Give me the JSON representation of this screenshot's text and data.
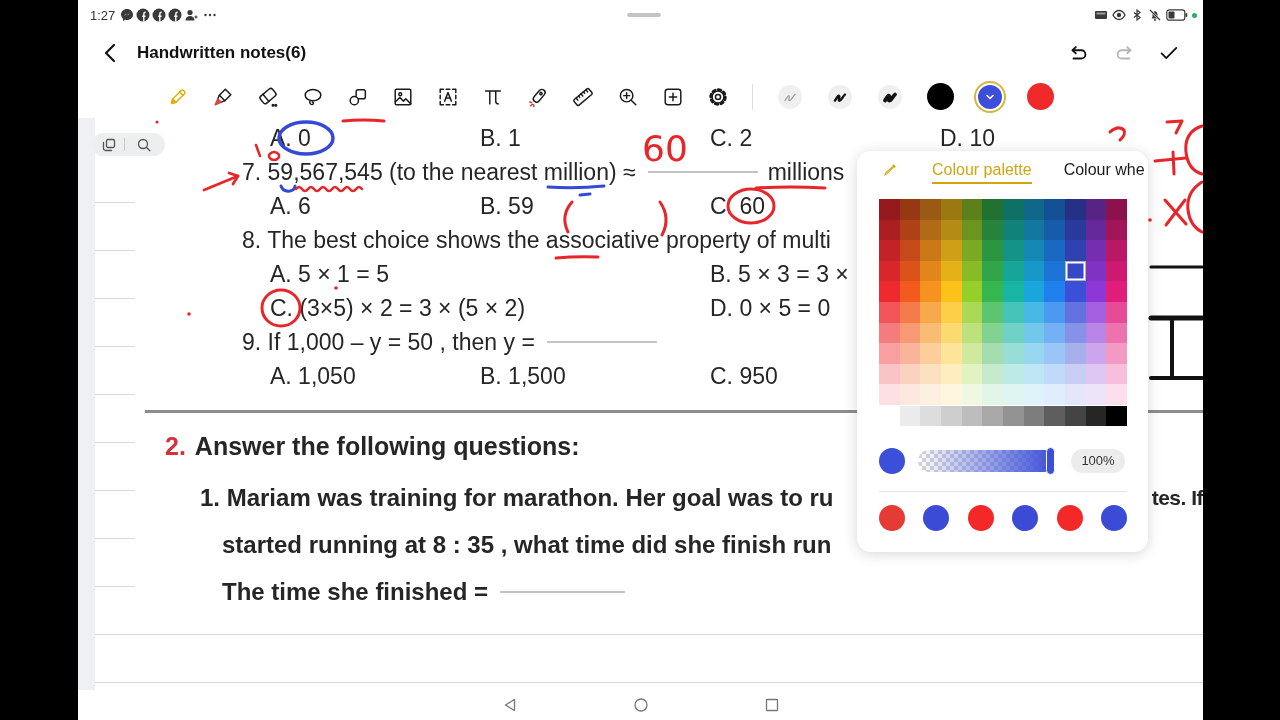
{
  "status_bar": {
    "time": "1:27"
  },
  "header": {
    "title": "Handwritten notes(6)",
    "actions": [
      {
        "kind": "undo",
        "disabled": false
      },
      {
        "kind": "redo",
        "disabled": true
      },
      {
        "kind": "done",
        "disabled": false
      }
    ]
  },
  "toolbar": {
    "tools": [
      {
        "kind": "pencil",
        "selected": true
      },
      {
        "kind": "marker",
        "selected": false
      },
      {
        "kind": "eraser",
        "selected": false
      },
      {
        "kind": "lasso",
        "selected": false
      },
      {
        "kind": "shapes",
        "selected": false
      },
      {
        "kind": "image",
        "selected": false
      },
      {
        "kind": "text",
        "selected": false
      },
      {
        "kind": "formula",
        "selected": false
      },
      {
        "kind": "laser",
        "selected": false
      },
      {
        "kind": "ruler",
        "selected": false
      },
      {
        "kind": "zoom",
        "selected": false
      },
      {
        "kind": "add",
        "selected": false
      },
      {
        "kind": "settings",
        "selected": false
      }
    ],
    "stroke_widths": [
      {
        "kind": "thin",
        "selected": false
      },
      {
        "kind": "medium",
        "selected": false
      },
      {
        "kind": "thick",
        "selected": false
      }
    ],
    "pen_colors": [
      {
        "color": "#000000",
        "selected": false
      },
      {
        "color": "#3b4fd8",
        "selected": true
      },
      {
        "color": "#f02a2a",
        "selected": false
      }
    ]
  },
  "worksheet": {
    "rows": [
      {
        "kind": "choices",
        "options": [
          "A. 0",
          "B. 1",
          "C. 2",
          "D. 10"
        ]
      },
      {
        "kind": "question",
        "text": "7. 59,567,545 (to the nearest million) ≈",
        "blank": true,
        "unit": "millions"
      },
      {
        "kind": "choices",
        "options": [
          "A. 6",
          "B. 59",
          "C. 60"
        ]
      },
      {
        "kind": "question",
        "text": "8. The best choice shows the associative property of multi"
      },
      {
        "kind": "choice_pair",
        "options": [
          "A. 5 × 1 = 5",
          "B. 5 × 3 = 3 ×"
        ]
      },
      {
        "kind": "choice_pair",
        "options": [
          "C. (3×5) × 2 = 3 × (5 × 2)",
          "D. 0 × 5 = 0"
        ]
      },
      {
        "kind": "question",
        "text": "9. If 1,000 – y = 50 , then y =",
        "blank": true
      },
      {
        "kind": "choices",
        "options": [
          "A. 1,050",
          "B. 1,500",
          "C. 950"
        ]
      }
    ],
    "section": {
      "number": "2.",
      "title": "Answer the following questions:",
      "lines": [
        {
          "text": "1. Mariam was training for marathon. Her goal was to ru",
          "tail": "tes. If"
        },
        {
          "text": "started running at 8 : 35 , what time did she finish run"
        },
        {
          "text": "The time she finished =",
          "blank": true
        }
      ]
    }
  },
  "handwriting": [
    {
      "text": "60"
    }
  ],
  "colour_panel": {
    "tabs": [
      {
        "label": "Colour palette",
        "selected": true
      },
      {
        "label": "Colour whe",
        "selected": false
      }
    ],
    "palette": [
      [
        {
          "color": "#941a1d",
          "selected": false
        },
        {
          "color": "#963813",
          "selected": false
        },
        {
          "color": "#995b13",
          "selected": false
        },
        {
          "color": "#9c7810",
          "selected": false
        },
        {
          "color": "#5c801a",
          "selected": false
        },
        {
          "color": "#217131",
          "selected": false
        },
        {
          "color": "#0f7066",
          "selected": false
        },
        {
          "color": "#106789",
          "selected": false
        },
        {
          "color": "#134f94",
          "selected": false
        },
        {
          "color": "#253186",
          "selected": false
        },
        {
          "color": "#572385",
          "selected": false
        },
        {
          "color": "#8c124d",
          "selected": false
        }
      ],
      [
        {
          "color": "#ab1e22",
          "selected": false
        },
        {
          "color": "#ae4116",
          "selected": false
        },
        {
          "color": "#b16a16",
          "selected": false
        },
        {
          "color": "#b58c13",
          "selected": false
        },
        {
          "color": "#6b951e",
          "selected": false
        },
        {
          "color": "#268339",
          "selected": false
        },
        {
          "color": "#118277",
          "selected": false
        },
        {
          "color": "#13789f",
          "selected": false
        },
        {
          "color": "#165cab",
          "selected": false
        },
        {
          "color": "#2a399c",
          "selected": false
        },
        {
          "color": "#66289a",
          "selected": false
        },
        {
          "color": "#a21559",
          "selected": false
        }
      ],
      [
        {
          "color": "#c32227",
          "selected": false
        },
        {
          "color": "#c64a19",
          "selected": false
        },
        {
          "color": "#ca7919",
          "selected": false
        },
        {
          "color": "#cf9f15",
          "selected": false
        },
        {
          "color": "#7aaa22",
          "selected": false
        },
        {
          "color": "#2b9541",
          "selected": false
        },
        {
          "color": "#149487",
          "selected": false
        },
        {
          "color": "#1588b5",
          "selected": false
        },
        {
          "color": "#1969c3",
          "selected": false
        },
        {
          "color": "#3041b1",
          "selected": false
        },
        {
          "color": "#742eaf",
          "selected": false
        },
        {
          "color": "#b91866",
          "selected": false
        }
      ],
      [
        {
          "color": "#d9262b",
          "selected": false
        },
        {
          "color": "#dc521b",
          "selected": false
        },
        {
          "color": "#e0861b",
          "selected": false
        },
        {
          "color": "#e5b118",
          "selected": false
        },
        {
          "color": "#88bc26",
          "selected": false
        },
        {
          "color": "#30a648",
          "selected": false
        },
        {
          "color": "#16a596",
          "selected": false
        },
        {
          "color": "#1897c9",
          "selected": false
        },
        {
          "color": "#1c74d9",
          "selected": false
        },
        {
          "color": "#3648c5",
          "selected": true
        },
        {
          "color": "#8033c3",
          "selected": false
        },
        {
          "color": "#cd1a71",
          "selected": false
        }
      ],
      [
        {
          "color": "#ee2a2f",
          "selected": false
        },
        {
          "color": "#f25a1e",
          "selected": false
        },
        {
          "color": "#f6931e",
          "selected": false
        },
        {
          "color": "#fcc21a",
          "selected": false
        },
        {
          "color": "#95cf2a",
          "selected": false
        },
        {
          "color": "#35b64f",
          "selected": false
        },
        {
          "color": "#18b5a5",
          "selected": false
        },
        {
          "color": "#1aa6dd",
          "selected": false
        },
        {
          "color": "#1f80ee",
          "selected": false
        },
        {
          "color": "#3b4fd8",
          "selected": false
        },
        {
          "color": "#8d38d6",
          "selected": false
        },
        {
          "color": "#e11d7c",
          "selected": false
        }
      ],
      [
        {
          "color": "#f15559",
          "selected": false
        },
        {
          "color": "#f57b4b",
          "selected": false
        },
        {
          "color": "#f8a94b",
          "selected": false
        },
        {
          "color": "#fdce48",
          "selected": false
        },
        {
          "color": "#aad955",
          "selected": false
        },
        {
          "color": "#5dc572",
          "selected": false
        },
        {
          "color": "#46c4b7",
          "selected": false
        },
        {
          "color": "#48b8e4",
          "selected": false
        },
        {
          "color": "#4c99f1",
          "selected": false
        },
        {
          "color": "#6272e0",
          "selected": false
        },
        {
          "color": "#a460de",
          "selected": false
        },
        {
          "color": "#e74a96",
          "selected": false
        }
      ],
      [
        {
          "color": "#f47b7e",
          "selected": false
        },
        {
          "color": "#f79973",
          "selected": false
        },
        {
          "color": "#f9bc73",
          "selected": false
        },
        {
          "color": "#fdd971",
          "selected": false
        },
        {
          "color": "#bde17b",
          "selected": false
        },
        {
          "color": "#82d292",
          "selected": false
        },
        {
          "color": "#70d1c7",
          "selected": false
        },
        {
          "color": "#71c8ea",
          "selected": false
        },
        {
          "color": "#74b0f4",
          "selected": false
        },
        {
          "color": "#8592e7",
          "selected": false
        },
        {
          "color": "#b884e6",
          "selected": false
        },
        {
          "color": "#ec73ae",
          "selected": false
        }
      ],
      [
        {
          "color": "#f79fa1",
          "selected": false
        },
        {
          "color": "#f9b49a",
          "selected": false
        },
        {
          "color": "#fbce9a",
          "selected": false
        },
        {
          "color": "#fee498",
          "selected": false
        },
        {
          "color": "#cfe99f",
          "selected": false
        },
        {
          "color": "#a4deb0",
          "selected": false
        },
        {
          "color": "#97ded7",
          "selected": false
        },
        {
          "color": "#98d7f0",
          "selected": false
        },
        {
          "color": "#9ac6f7",
          "selected": false
        },
        {
          "color": "#a7b0ed",
          "selected": false
        },
        {
          "color": "#cca5ed",
          "selected": false
        },
        {
          "color": "#f299c4",
          "selected": false
        }
      ],
      [
        {
          "color": "#fac3c5",
          "selected": false
        },
        {
          "color": "#fbd1c0",
          "selected": false
        },
        {
          "color": "#fce1c0",
          "selected": false
        },
        {
          "color": "#feeebf",
          "selected": false
        },
        {
          "color": "#e1f2c3",
          "selected": false
        },
        {
          "color": "#c6eace",
          "selected": false
        },
        {
          "color": "#beeae6",
          "selected": false
        },
        {
          "color": "#bfe6f5",
          "selected": false
        },
        {
          "color": "#c0dbfa",
          "selected": false
        },
        {
          "color": "#c8cef4",
          "selected": false
        },
        {
          "color": "#dfc7f4",
          "selected": false
        },
        {
          "color": "#f7bfda",
          "selected": false
        }
      ],
      [
        {
          "color": "#fde1e2",
          "selected": false
        },
        {
          "color": "#fde8e0",
          "selected": false
        },
        {
          "color": "#fef0e0",
          "selected": false
        },
        {
          "color": "#fff6df",
          "selected": false
        },
        {
          "color": "#f0f8e1",
          "selected": false
        },
        {
          "color": "#e3f5e6",
          "selected": false
        },
        {
          "color": "#dff5f2",
          "selected": false
        },
        {
          "color": "#dff3fa",
          "selected": false
        },
        {
          "color": "#e0edfd",
          "selected": false
        },
        {
          "color": "#e4e6fa",
          "selected": false
        },
        {
          "color": "#efe3f9",
          "selected": false
        },
        {
          "color": "#fbdfed",
          "selected": false
        }
      ]
    ],
    "greys": [
      {
        "color": "#ebebeb",
        "selected": false
      },
      {
        "color": "#dddddd",
        "selected": false
      },
      {
        "color": "#cecece",
        "selected": false
      },
      {
        "color": "#bdbdbd",
        "selected": false
      },
      {
        "color": "#a8a8a8",
        "selected": false
      },
      {
        "color": "#939393",
        "selected": false
      },
      {
        "color": "#7d7d7d",
        "selected": false
      },
      {
        "color": "#5e5e5e",
        "selected": false
      },
      {
        "color": "#444444",
        "selected": false
      },
      {
        "color": "#262626",
        "selected": false
      },
      {
        "color": "#000000",
        "selected": false
      }
    ],
    "opacity": {
      "level": 1,
      "reading": "100%"
    },
    "recent_colors": [
      {
        "color": "#e63a35",
        "selected": false
      },
      {
        "color": "#3b4bd6",
        "selected": false
      },
      {
        "color": "#f52828",
        "selected": false
      },
      {
        "color": "#3b4bd6",
        "selected": false
      },
      {
        "color": "#f52828",
        "selected": false
      },
      {
        "color": "#3b4bd6",
        "selected": false
      }
    ]
  }
}
